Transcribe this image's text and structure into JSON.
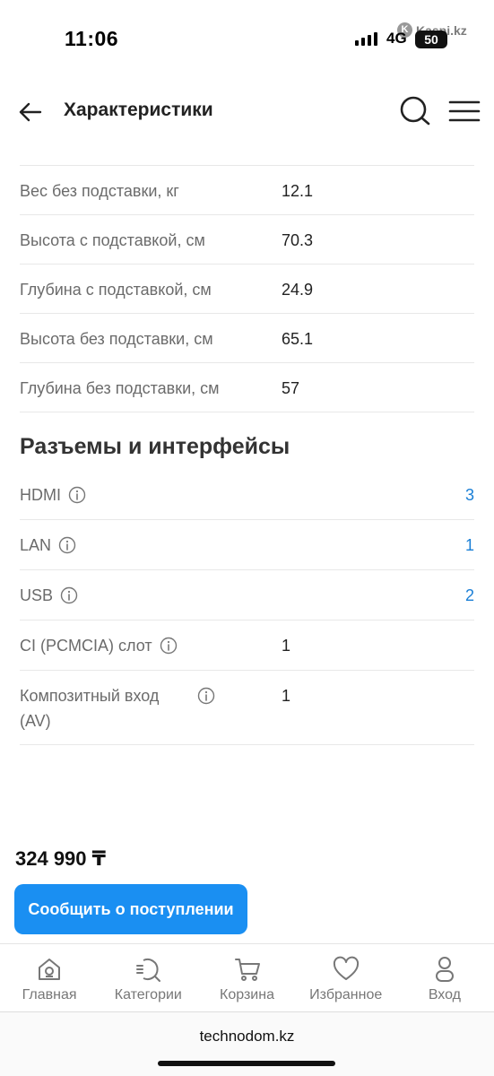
{
  "status_bar": {
    "time": "11:06",
    "network": "4G",
    "battery": "50",
    "overlay_app": "Kaspi.kz"
  },
  "header": {
    "title": "Характеристики"
  },
  "specs": [
    {
      "name": "Вес без подставки, кг",
      "value": "12.1"
    },
    {
      "name": "Высота с подставкой, см",
      "value": "70.3"
    },
    {
      "name": "Глубина с подставкой, см",
      "value": "24.9"
    },
    {
      "name": "Высота без подставки, см",
      "value": "65.1"
    },
    {
      "name": "Глубина без подставки, см",
      "value": "57"
    }
  ],
  "interfaces": {
    "title": "Разъемы и интерфейсы",
    "items": [
      {
        "name": "HDMI",
        "value": "3"
      },
      {
        "name": "LAN",
        "value": "1"
      },
      {
        "name": "USB",
        "value": "2"
      },
      {
        "name": "CI (PCMCIA) слот",
        "value": "1"
      },
      {
        "name": "Композитный вход (AV)",
        "value": "1"
      }
    ]
  },
  "product": {
    "price": "324 990 ₸",
    "notify_label": "Сообщить о поступлении"
  },
  "bottom_nav": {
    "items": [
      {
        "label": "Главная",
        "icon": "home-icon"
      },
      {
        "label": "Категории",
        "icon": "categories-search-icon"
      },
      {
        "label": "Корзина",
        "icon": "cart-icon"
      },
      {
        "label": "Избранное",
        "icon": "heart-icon"
      },
      {
        "label": "Вход",
        "icon": "user-icon"
      }
    ]
  },
  "browser": {
    "url": "technodom.kz"
  },
  "colors": {
    "accent": "#1a8ff2",
    "link": "#1a7fd6"
  }
}
